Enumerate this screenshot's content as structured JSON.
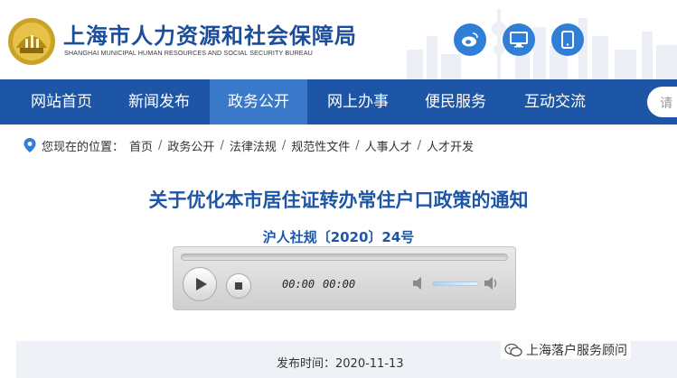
{
  "header": {
    "title": "上海市人力资源和社会保障局",
    "subtitle": "SHANGHAI MUNICIPAL HUMAN RESOURCES AND SOCIAL SECURITY BUREAU",
    "icons": [
      "weibo-icon",
      "computer-icon",
      "mobile-icon"
    ]
  },
  "nav": {
    "items": [
      "网站首页",
      "新闻发布",
      "政务公开",
      "网上办事",
      "便民服务",
      "互动交流"
    ],
    "active_index": 2,
    "search_placeholder": "请"
  },
  "breadcrumb": {
    "prefix": "您现在的位置：",
    "items": [
      "首页",
      "政务公开",
      "法律法规",
      "规范性文件",
      "人事人才",
      "人才开发"
    ],
    "separator": "/"
  },
  "article": {
    "title": "关于优化本市居住证转办常住户口政策的通知",
    "doc_number": "沪人社规〔2020〕24号"
  },
  "player": {
    "current_time": "00:00",
    "total_time": "00:00"
  },
  "meta": {
    "publish_date_label": "发布时间：2020-11-13"
  },
  "watermark": {
    "text": "上海落户服务顾问"
  },
  "colors": {
    "brand_blue": "#1e56a7",
    "nav_active": "#3a78c9",
    "icon_circle": "#2f7fd6"
  }
}
